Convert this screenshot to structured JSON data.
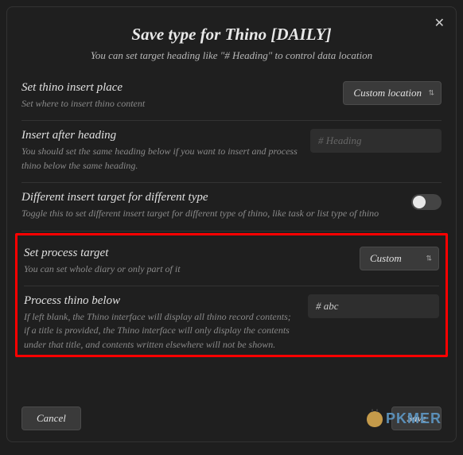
{
  "header": {
    "title": "Save type for Thino [DAILY]",
    "subtitle": "You can set target heading like \"# Heading\" to control data location"
  },
  "rows": {
    "insert_place": {
      "title": "Set thino insert place",
      "desc": "Set where to insert thino content",
      "select_value": "Custom location"
    },
    "after_heading": {
      "title": "Insert after heading",
      "desc": "You should set the same heading below if you want to insert and process thino below the same heading.",
      "placeholder": "# Heading",
      "value": ""
    },
    "diff_target": {
      "title": "Different insert target for different type",
      "desc": "Toggle this to set different insert target for different type of thino, like task or list type of thino"
    },
    "process_target": {
      "title": "Set process target",
      "desc": "You can set whole diary or only part of it",
      "select_value": "Custom"
    },
    "process_below": {
      "title": "Process thino below",
      "desc": "If left blank, the Thino interface will display all thino record contents; if a title is provided, the Thino interface will only display the contents under that title, and contents written elsewhere will not be shown.",
      "value": "# abc"
    }
  },
  "footer": {
    "cancel": "Cancel",
    "save": "Save"
  },
  "watermark": "PKMER"
}
